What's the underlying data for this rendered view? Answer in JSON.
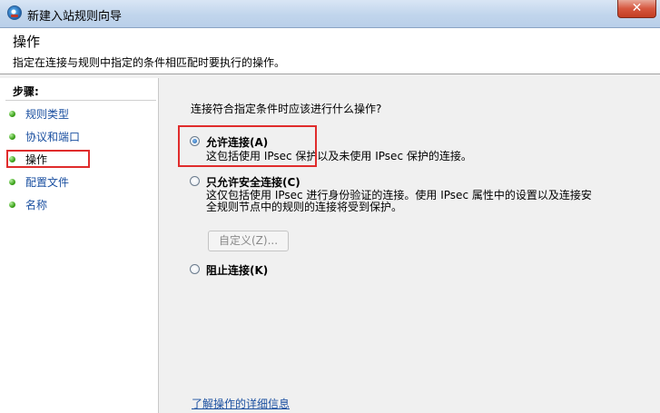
{
  "window": {
    "title": "新建入站规则向导",
    "close_glyph": "✕"
  },
  "header": {
    "title": "操作",
    "subtitle": "指定在连接与规则中指定的条件相匹配时要执行的操作。"
  },
  "sidebar": {
    "title": "步骤:",
    "items": [
      {
        "label": "规则类型",
        "current": false
      },
      {
        "label": "协议和端口",
        "current": false
      },
      {
        "label": "操作",
        "current": true
      },
      {
        "label": "配置文件",
        "current": false
      },
      {
        "label": "名称",
        "current": false
      }
    ]
  },
  "main": {
    "question": "连接符合指定条件时应该进行什么操作?",
    "options": [
      {
        "label": "允许连接(A)",
        "selected": true,
        "desc": [
          "这包括使用 IPsec 保护以及未使用 IPsec 保护的连接。"
        ]
      },
      {
        "label": "只允许安全连接(C)",
        "selected": false,
        "desc": [
          "这仅包括使用 IPsec 进行身份验证的连接。使用 IPsec 属性中的设置以及连接安",
          "全规则节点中的规则的连接将受到保护。"
        ]
      },
      {
        "label": "阻止连接(K)",
        "selected": false,
        "desc": []
      }
    ],
    "customize_button": "自定义(Z)...",
    "learn_more_link": "了解操作的详细信息"
  },
  "colors": {
    "highlight": "#e02c2c",
    "link": "#1a4fa0",
    "step_dot": "#3ea51c"
  }
}
